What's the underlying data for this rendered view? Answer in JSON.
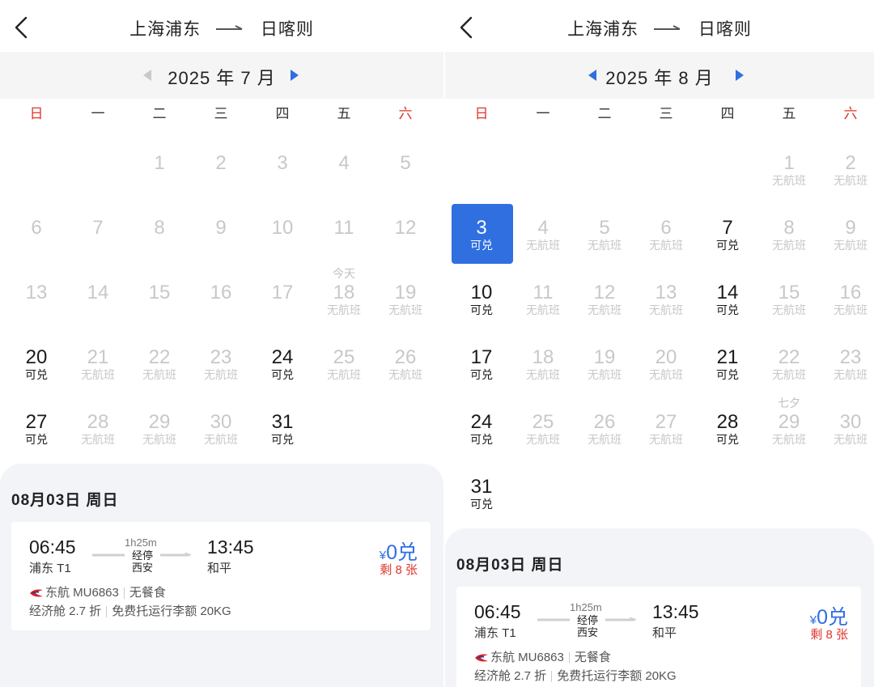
{
  "route": {
    "from": "上海浦东",
    "to": "日喀则"
  },
  "weekdays": [
    "日",
    "一",
    "二",
    "三",
    "四",
    "五",
    "六"
  ],
  "colors": {
    "accent": "#2f6fe0",
    "weekend": "#e0352b",
    "disabled": "#c8c8c8"
  },
  "panels": [
    {
      "month_title": "2025 年 7 月",
      "prev_enabled": false,
      "next_enabled": true,
      "days": [
        {
          "n": "1",
          "row": 0,
          "col": 2,
          "sub": "",
          "state": "disabled"
        },
        {
          "n": "2",
          "row": 0,
          "col": 3,
          "sub": "",
          "state": "disabled"
        },
        {
          "n": "3",
          "row": 0,
          "col": 4,
          "sub": "",
          "state": "disabled"
        },
        {
          "n": "4",
          "row": 0,
          "col": 5,
          "sub": "",
          "state": "disabled"
        },
        {
          "n": "5",
          "row": 0,
          "col": 6,
          "sub": "",
          "state": "disabled"
        },
        {
          "n": "6",
          "row": 1,
          "col": 0,
          "sub": "",
          "state": "disabled"
        },
        {
          "n": "7",
          "row": 1,
          "col": 1,
          "sub": "",
          "state": "disabled"
        },
        {
          "n": "8",
          "row": 1,
          "col": 2,
          "sub": "",
          "state": "disabled"
        },
        {
          "n": "9",
          "row": 1,
          "col": 3,
          "sub": "",
          "state": "disabled"
        },
        {
          "n": "10",
          "row": 1,
          "col": 4,
          "sub": "",
          "state": "disabled"
        },
        {
          "n": "11",
          "row": 1,
          "col": 5,
          "sub": "",
          "state": "disabled"
        },
        {
          "n": "12",
          "row": 1,
          "col": 6,
          "sub": "",
          "state": "disabled"
        },
        {
          "n": "13",
          "row": 2,
          "col": 0,
          "sub": "",
          "state": "disabled"
        },
        {
          "n": "14",
          "row": 2,
          "col": 1,
          "sub": "",
          "state": "disabled"
        },
        {
          "n": "15",
          "row": 2,
          "col": 2,
          "sub": "",
          "state": "disabled"
        },
        {
          "n": "16",
          "row": 2,
          "col": 3,
          "sub": "",
          "state": "disabled"
        },
        {
          "n": "17",
          "row": 2,
          "col": 4,
          "sub": "",
          "state": "disabled"
        },
        {
          "n": "18",
          "row": 2,
          "col": 5,
          "sub": "无航班",
          "note": "今天",
          "state": "disabled"
        },
        {
          "n": "19",
          "row": 2,
          "col": 6,
          "sub": "无航班",
          "state": "disabled"
        },
        {
          "n": "20",
          "row": 3,
          "col": 0,
          "sub": "可兑",
          "state": "avail"
        },
        {
          "n": "21",
          "row": 3,
          "col": 1,
          "sub": "无航班",
          "state": "disabled"
        },
        {
          "n": "22",
          "row": 3,
          "col": 2,
          "sub": "无航班",
          "state": "disabled"
        },
        {
          "n": "23",
          "row": 3,
          "col": 3,
          "sub": "无航班",
          "state": "disabled"
        },
        {
          "n": "24",
          "row": 3,
          "col": 4,
          "sub": "可兑",
          "state": "avail"
        },
        {
          "n": "25",
          "row": 3,
          "col": 5,
          "sub": "无航班",
          "state": "disabled"
        },
        {
          "n": "26",
          "row": 3,
          "col": 6,
          "sub": "无航班",
          "state": "disabled"
        },
        {
          "n": "27",
          "row": 4,
          "col": 0,
          "sub": "可兑",
          "state": "avail"
        },
        {
          "n": "28",
          "row": 4,
          "col": 1,
          "sub": "无航班",
          "state": "disabled"
        },
        {
          "n": "29",
          "row": 4,
          "col": 2,
          "sub": "无航班",
          "state": "disabled"
        },
        {
          "n": "30",
          "row": 4,
          "col": 3,
          "sub": "无航班",
          "state": "disabled"
        },
        {
          "n": "31",
          "row": 4,
          "col": 4,
          "sub": "可兑",
          "state": "avail"
        }
      ],
      "rows": 5
    },
    {
      "month_title": "2025 年 8 月",
      "prev_enabled": true,
      "next_enabled": true,
      "days": [
        {
          "n": "1",
          "row": 0,
          "col": 5,
          "sub": "无航班",
          "state": "disabled"
        },
        {
          "n": "2",
          "row": 0,
          "col": 6,
          "sub": "无航班",
          "state": "disabled"
        },
        {
          "n": "3",
          "row": 1,
          "col": 0,
          "sub": "可兑",
          "state": "selected"
        },
        {
          "n": "4",
          "row": 1,
          "col": 1,
          "sub": "无航班",
          "state": "disabled"
        },
        {
          "n": "5",
          "row": 1,
          "col": 2,
          "sub": "无航班",
          "state": "disabled"
        },
        {
          "n": "6",
          "row": 1,
          "col": 3,
          "sub": "无航班",
          "state": "disabled"
        },
        {
          "n": "7",
          "row": 1,
          "col": 4,
          "sub": "可兑",
          "state": "avail"
        },
        {
          "n": "8",
          "row": 1,
          "col": 5,
          "sub": "无航班",
          "state": "disabled"
        },
        {
          "n": "9",
          "row": 1,
          "col": 6,
          "sub": "无航班",
          "state": "disabled"
        },
        {
          "n": "10",
          "row": 2,
          "col": 0,
          "sub": "可兑",
          "state": "avail"
        },
        {
          "n": "11",
          "row": 2,
          "col": 1,
          "sub": "无航班",
          "state": "disabled"
        },
        {
          "n": "12",
          "row": 2,
          "col": 2,
          "sub": "无航班",
          "state": "disabled"
        },
        {
          "n": "13",
          "row": 2,
          "col": 3,
          "sub": "无航班",
          "state": "disabled"
        },
        {
          "n": "14",
          "row": 2,
          "col": 4,
          "sub": "可兑",
          "state": "avail"
        },
        {
          "n": "15",
          "row": 2,
          "col": 5,
          "sub": "无航班",
          "state": "disabled"
        },
        {
          "n": "16",
          "row": 2,
          "col": 6,
          "sub": "无航班",
          "state": "disabled"
        },
        {
          "n": "17",
          "row": 3,
          "col": 0,
          "sub": "可兑",
          "state": "avail"
        },
        {
          "n": "18",
          "row": 3,
          "col": 1,
          "sub": "无航班",
          "state": "disabled"
        },
        {
          "n": "19",
          "row": 3,
          "col": 2,
          "sub": "无航班",
          "state": "disabled"
        },
        {
          "n": "20",
          "row": 3,
          "col": 3,
          "sub": "无航班",
          "state": "disabled"
        },
        {
          "n": "21",
          "row": 3,
          "col": 4,
          "sub": "可兑",
          "state": "avail"
        },
        {
          "n": "22",
          "row": 3,
          "col": 5,
          "sub": "无航班",
          "state": "disabled"
        },
        {
          "n": "23",
          "row": 3,
          "col": 6,
          "sub": "无航班",
          "state": "disabled"
        },
        {
          "n": "24",
          "row": 4,
          "col": 0,
          "sub": "可兑",
          "state": "avail"
        },
        {
          "n": "25",
          "row": 4,
          "col": 1,
          "sub": "无航班",
          "state": "disabled"
        },
        {
          "n": "26",
          "row": 4,
          "col": 2,
          "sub": "无航班",
          "state": "disabled"
        },
        {
          "n": "27",
          "row": 4,
          "col": 3,
          "sub": "无航班",
          "state": "disabled"
        },
        {
          "n": "28",
          "row": 4,
          "col": 4,
          "sub": "可兑",
          "state": "avail"
        },
        {
          "n": "29",
          "row": 4,
          "col": 5,
          "sub": "无航班",
          "note": "七夕",
          "state": "disabled"
        },
        {
          "n": "30",
          "row": 4,
          "col": 6,
          "sub": "无航班",
          "state": "disabled"
        },
        {
          "n": "31",
          "row": 5,
          "col": 0,
          "sub": "可兑",
          "state": "avail"
        }
      ],
      "rows": 6
    }
  ],
  "flight": {
    "date_label": "08月03日 周日",
    "dep_time": "06:45",
    "dep_airport": "浦东 T1",
    "duration": "1h25m",
    "stop_label": "经停",
    "stop_city": "西安",
    "arr_time": "13:45",
    "arr_airport": "和平",
    "price_symbol": "¥",
    "price_amount": "0兑",
    "remaining": "剩 8 张",
    "airline": "东航 MU6863",
    "meal": "无餐食",
    "cabin": "经济舱 2.7 折",
    "baggage": "免费托运行李额 20KG"
  }
}
